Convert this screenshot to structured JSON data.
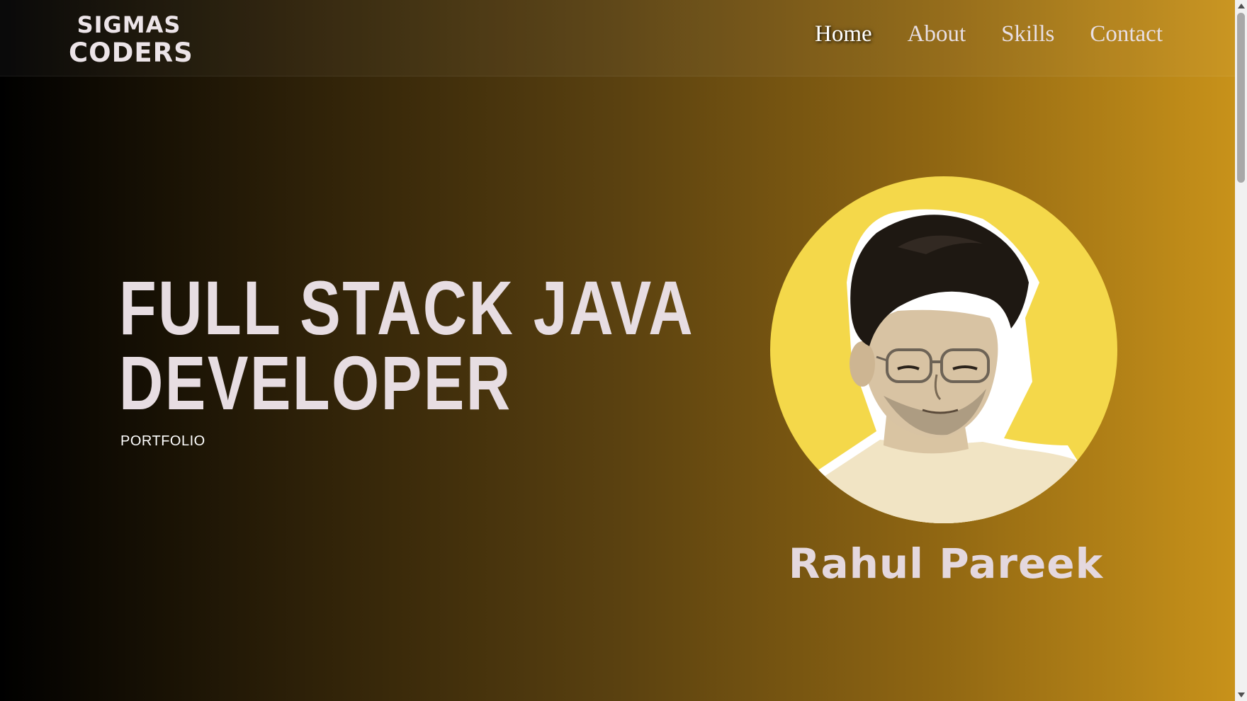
{
  "brand": {
    "line1": "SIGMAS",
    "line2": "CODERS"
  },
  "nav": {
    "items": [
      "Home",
      "About",
      "Skills",
      "Contact"
    ],
    "active": "Home"
  },
  "hero": {
    "title_line1": "FULL STACK JAVA",
    "title_line2": "DEVELOPER",
    "subtitle": "PORTFOLIO"
  },
  "profile": {
    "name": "Rahul Pareek",
    "avatar_icon": "profile-photo"
  },
  "colors": {
    "gradient_start": "#000000",
    "gradient_end": "#c8921a",
    "avatar_bg": "#f4d84a",
    "text_light": "#e7dde2"
  }
}
